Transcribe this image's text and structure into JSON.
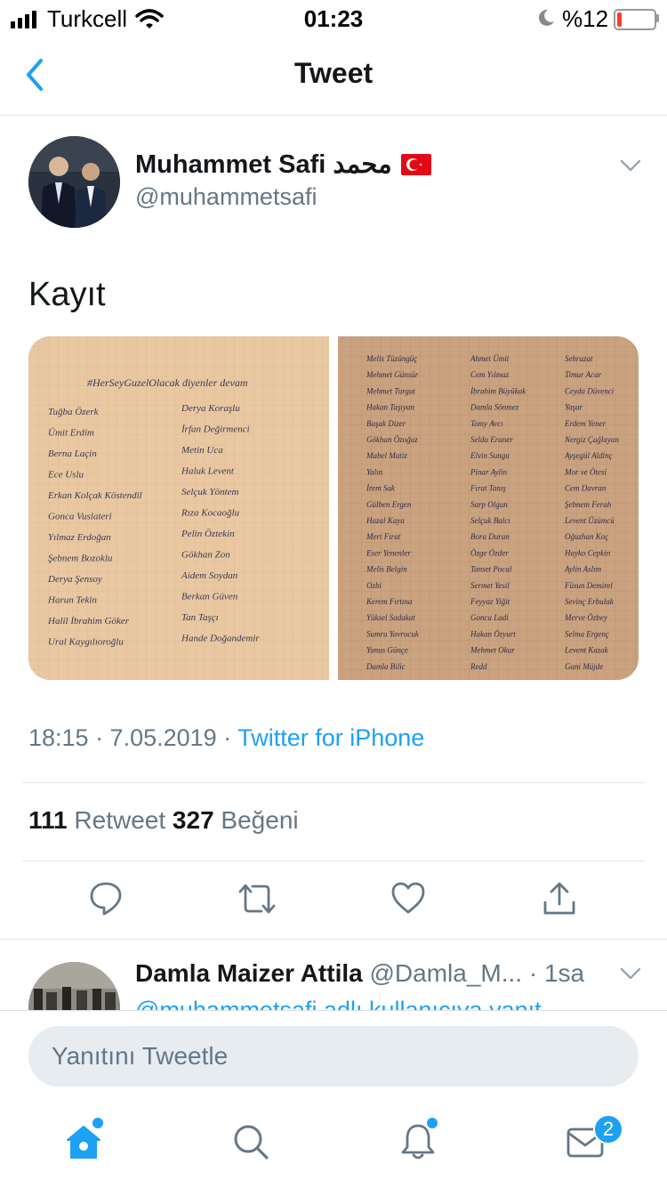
{
  "status_bar": {
    "carrier": "Turkcell",
    "time": "01:23",
    "battery": "%12",
    "battery_level": 0.12
  },
  "nav": {
    "title": "Tweet"
  },
  "tweet": {
    "author_name": "Muhammet Safi محمد",
    "author_handle": "@muhammetsafi",
    "text": "Kayıt",
    "timestamp": "18:15 · 7.05.2019 · ",
    "source": "Twitter for iPhone",
    "retweets": "111",
    "retweets_label": " Retweet ",
    "likes": "327",
    "likes_label": " Beğeni"
  },
  "photo_left": {
    "header": "#HerSeyGuzelOlacak diyenler devam",
    "names": [
      [
        "Tuğba Özerk",
        "Derya Koraşlu"
      ],
      [
        "Ümit Erdim",
        "İrfan Değirmenci"
      ],
      [
        "Berna Laçin",
        "Metin Uca"
      ],
      [
        "Ece Uslu",
        "Haluk Levent"
      ],
      [
        "Erkan Kolçak Köstendil",
        "Selçuk Yöntem"
      ],
      [
        "Gonca Vuslateri",
        "Rıza Kocaoğlu"
      ],
      [
        "Yılmaz Erdoğan",
        "Pelin Öztekin"
      ],
      [
        "Şebnem Bozoklu",
        "Gökhan Zon"
      ],
      [
        "Derya Şensoy",
        "Aidem Soydan"
      ],
      [
        "Harun Tekin",
        "Berkan Güven"
      ],
      [
        "Halil İbrahim Göker",
        "Tan Taşçı"
      ],
      [
        "Ural Kaygılıoroğlu",
        "Hande Doğandemir"
      ]
    ]
  },
  "photo_right": {
    "names": [
      [
        "Melis Tüzüngüç",
        "Ahmet Ümit",
        "Sehrazat"
      ],
      [
        "Mehmet Günsür",
        "Cem Yılmaz",
        "Timur Acar"
      ],
      [
        "Mehmet Turgut",
        "İbrahim Büyükak",
        "Ceyda Düvenci"
      ],
      [
        "Hakan Taşıyan",
        "Damla Sönmez",
        "Yaşar"
      ],
      [
        "Başak Dizer",
        "Tomy Avcı",
        "Erdem Yener"
      ],
      [
        "Gökhan Özoğuz",
        "Selda Eraner",
        "Nergiz Çağlayan"
      ],
      [
        "Mabel Matiz",
        "Elvin Sungu",
        "Ayşegül Aldinç"
      ],
      [
        "Yalın",
        "Pinar Aylin",
        "Mor ve Ötesi"
      ],
      [
        "İrem Sak",
        "Fırat Tanış",
        "Cem Davran"
      ],
      [
        "Gülben Ergen",
        "Sarp Olgun",
        "Şebnem Ferah"
      ],
      [
        "Hazal Kaya",
        "Selçuk Balcı",
        "Levent Üzümcü"
      ],
      [
        "Mert Fırat",
        "Bora Duran",
        "Oğuzhan Koç"
      ],
      [
        "Eser Yenenler",
        "Özge Özder",
        "Hayko Cepkin"
      ],
      [
        "Melis Belgin",
        "Tanset Pocal",
        "Aylin Aslım"
      ],
      [
        "Ozbi",
        "Sermet Yesil",
        "Füsun Demirel"
      ],
      [
        "Kerem Fırtına",
        "Feyyaz Yiğit",
        "Sevinç Erbulak"
      ],
      [
        "Yüksel Sadakat",
        "Gonca Ladi",
        "Merve Özbey"
      ],
      [
        "Sumru Yavrucuk",
        "Hakan Özyurt",
        "Selma Ergenç"
      ],
      [
        "Yunus Günçe",
        "Mehmet Okur",
        "Levent Kazak"
      ],
      [
        "Damla Bilic",
        "Redd",
        "Gani Müjde"
      ]
    ]
  },
  "reply": {
    "author_name": "Damla Maizer Attila",
    "author_handle": " @Damla_M... · 1sa",
    "replying_to": "@muhammetsafi adlı kullanıcıya yanıt"
  },
  "compose": {
    "placeholder": "Yanıtını Tweetle"
  },
  "tabs": {
    "messages_badge": "2"
  },
  "colors": {
    "accent": "#1da1f2",
    "secondary_text": "#657786",
    "divider": "#e1e8ed",
    "flag": "#e30a17"
  }
}
